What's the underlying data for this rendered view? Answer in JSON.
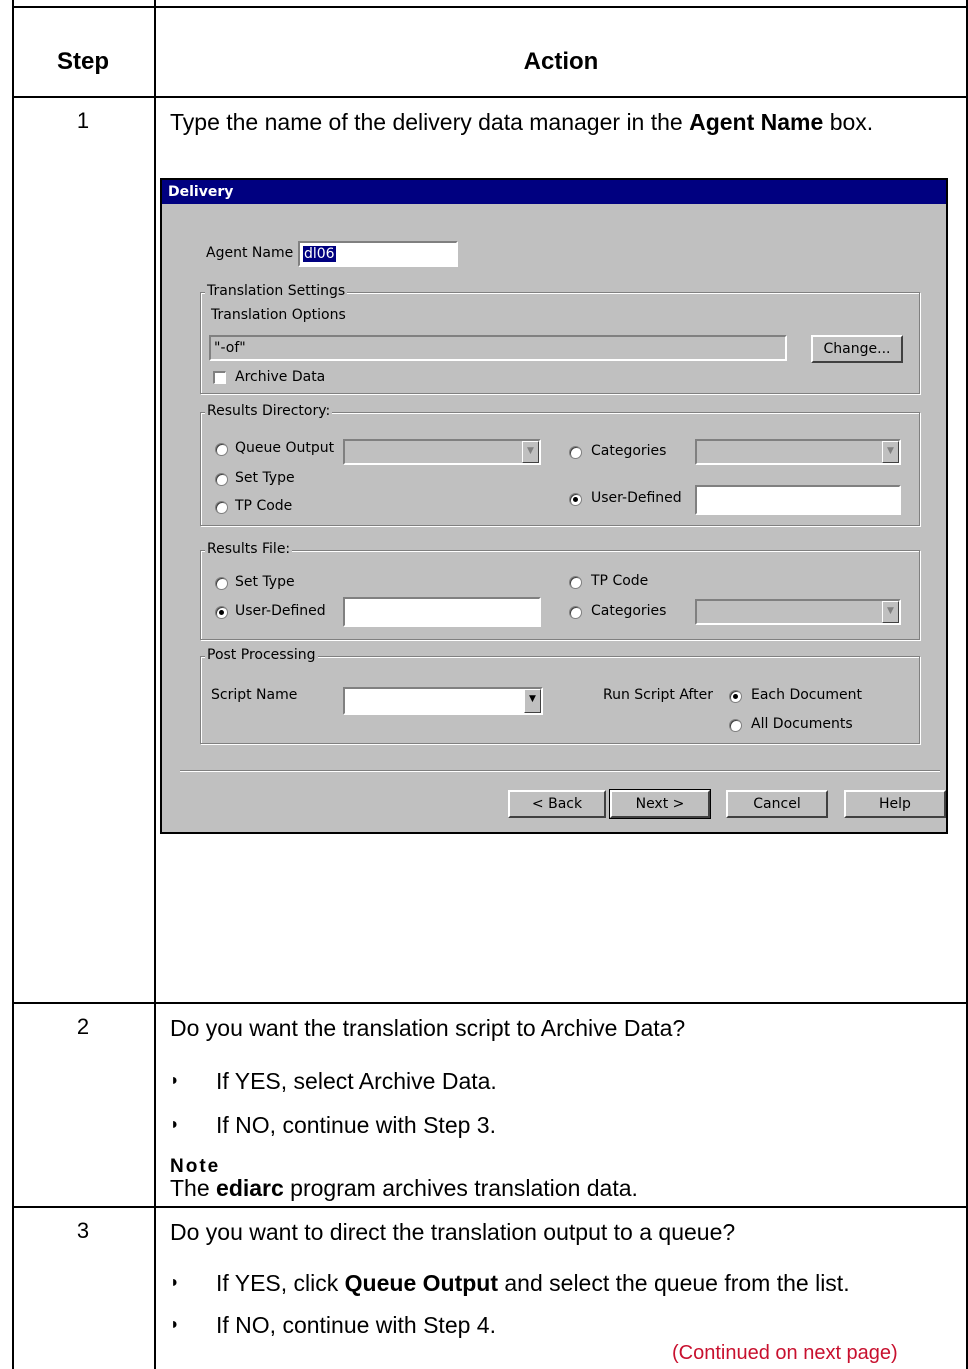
{
  "table": {
    "header_step": "Step",
    "header_action": "Action"
  },
  "rows": [
    {
      "step": "1",
      "text_before": "Type the name of the delivery data manager in the ",
      "text_bold": "Agent Name",
      "text_after": " box."
    },
    {
      "step": "2",
      "question": "Do you want the translation script to Archive Data?",
      "bullets": [
        "If YES, select Archive Data.",
        "If NO, continue with Step 3."
      ],
      "note_title": "Note",
      "note_before": "The ",
      "note_bold": "ediarc",
      "note_after": " program archives translation data."
    },
    {
      "step": "3",
      "question": "Do you want to direct the translation output to a queue?",
      "bullet1_before": "If YES, click ",
      "bullet1_bold": "Queue Output",
      "bullet1_after": " and select the queue from the list.",
      "bullet2": "If NO, continue with Step 4."
    }
  ],
  "continued": "(Continued on next page)",
  "dialog": {
    "title": "Delivery",
    "agent_name_label": "Agent Name",
    "agent_name_value": "dl06",
    "translation_settings": {
      "title": "Translation Settings",
      "options_label": "Translation Options",
      "options_value": "\"-of\"",
      "change_button": "Change...",
      "archive_data_label": "Archive Data",
      "archive_data_checked": false
    },
    "results_directory": {
      "title": "Results Directory:",
      "queue_output": "Queue Output",
      "set_type": "Set Type",
      "tp_code": "TP Code",
      "categories": "Categories",
      "user_defined": "User-Defined",
      "selected": "User-Defined"
    },
    "results_file": {
      "title": "Results File:",
      "set_type": "Set Type",
      "user_defined": "User-Defined",
      "tp_code": "TP Code",
      "categories": "Categories",
      "selected": "User-Defined"
    },
    "post_processing": {
      "title": "Post Processing",
      "script_name_label": "Script Name",
      "run_after_label": "Run Script After",
      "each_document": "Each Document",
      "all_documents": "All Documents",
      "selected": "Each Document"
    },
    "buttons": {
      "back": "< Back",
      "next": "Next >",
      "cancel": "Cancel",
      "help": "Help"
    }
  },
  "icons": {
    "bullet": "bullet-icon",
    "dropdown_arrow": "chevron-down-icon"
  }
}
